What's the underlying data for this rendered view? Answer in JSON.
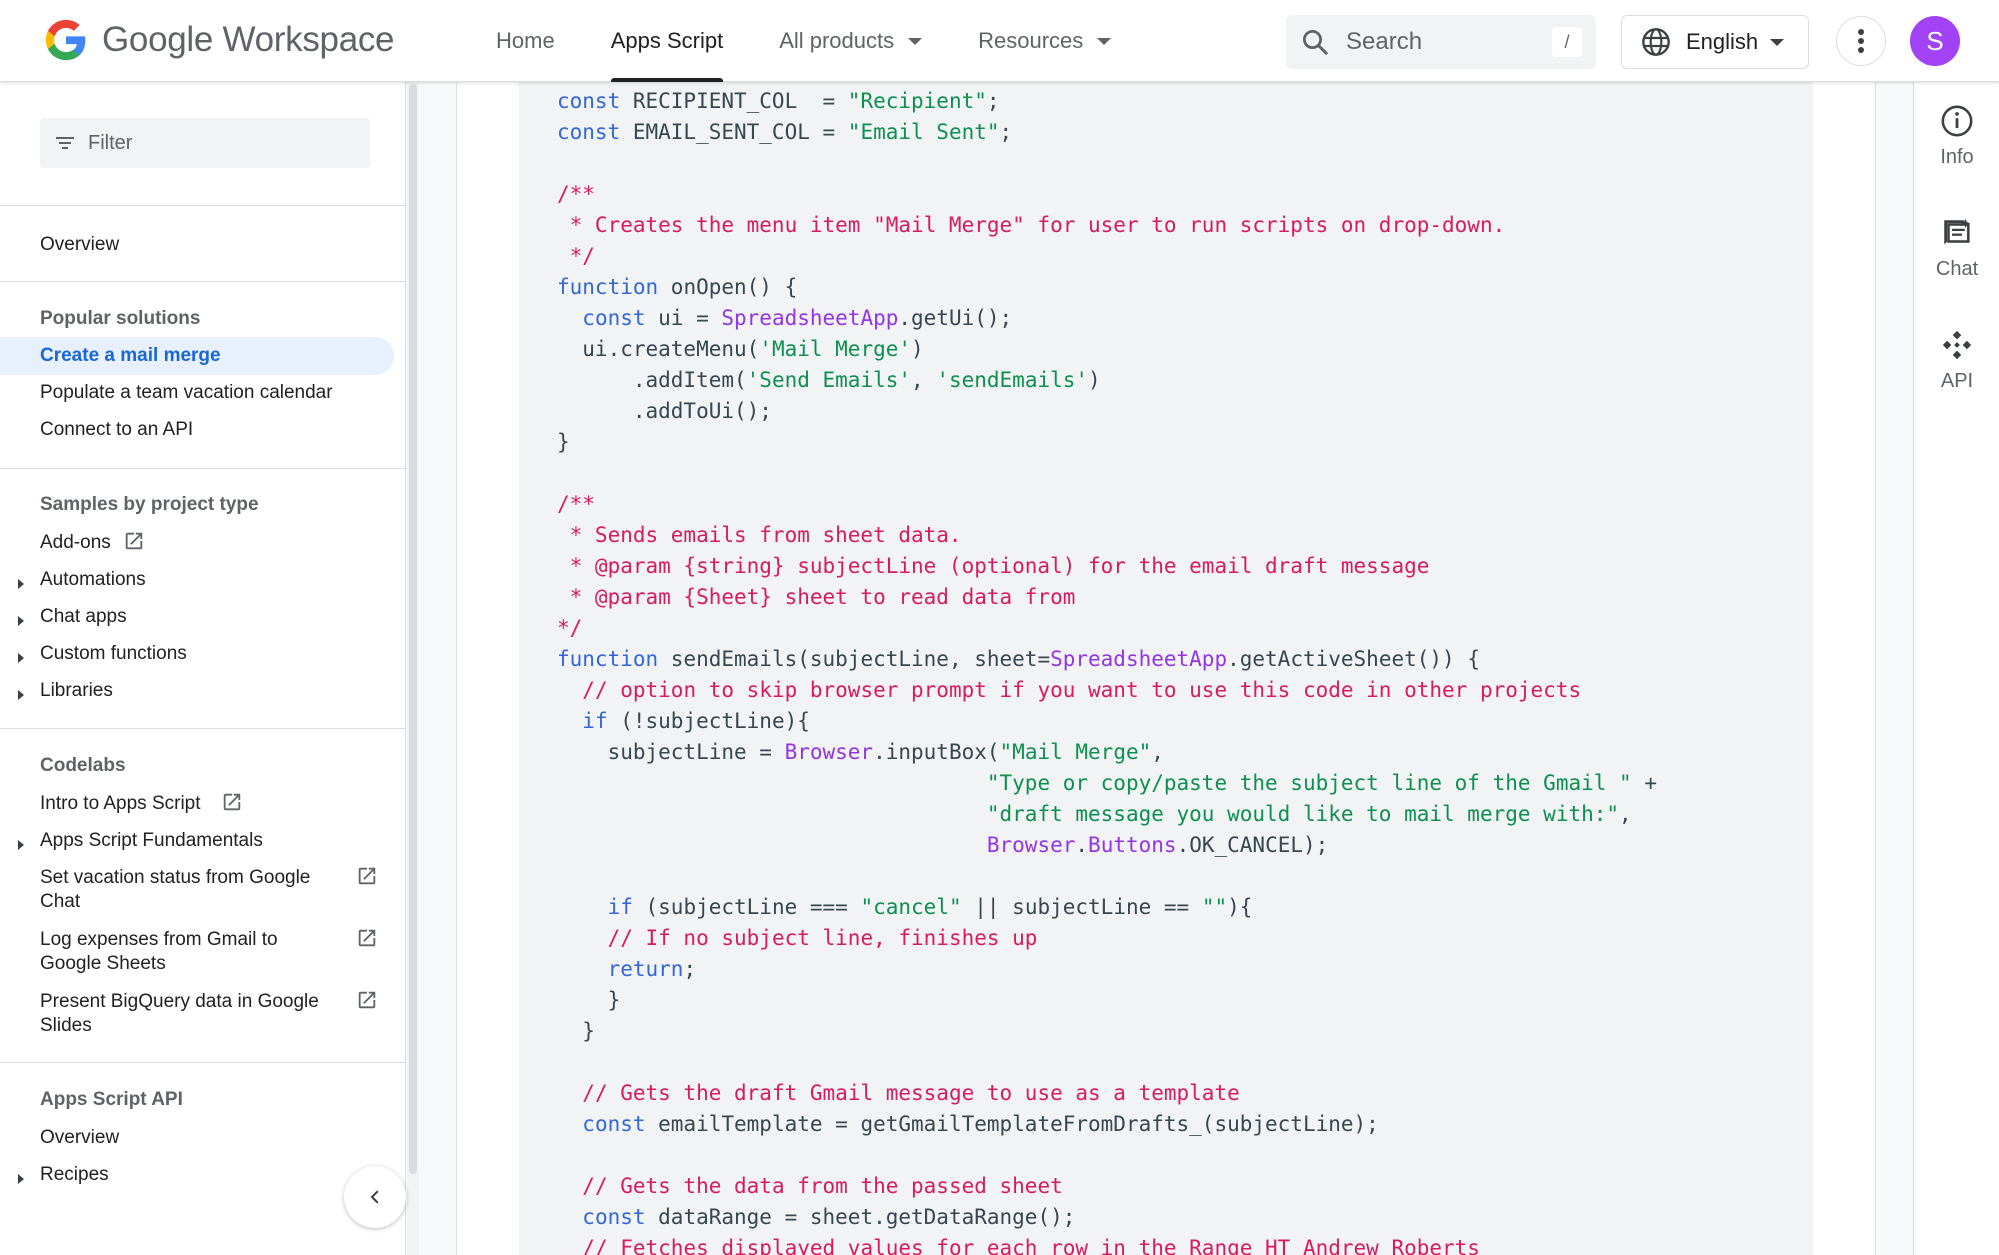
{
  "header": {
    "brand_google": "Google",
    "brand_product": "Workspace",
    "nav": [
      {
        "label": "Home"
      },
      {
        "label": "Apps Script"
      },
      {
        "label": "All products"
      },
      {
        "label": "Resources"
      }
    ],
    "search_placeholder": "Search",
    "search_shortcut": "/",
    "language": "English",
    "avatar_initial": "S"
  },
  "sidebar": {
    "filter_placeholder": "Filter",
    "overview": "Overview",
    "sections": {
      "popular": {
        "heading": "Popular solutions",
        "items": [
          "Create a mail merge",
          "Populate a team vacation calendar",
          "Connect to an API"
        ]
      },
      "samples": {
        "heading": "Samples by project type",
        "items": [
          "Add-ons",
          "Automations",
          "Chat apps",
          "Custom functions",
          "Libraries"
        ]
      },
      "codelabs": {
        "heading": "Codelabs",
        "items": [
          "Intro to Apps Script",
          "Apps Script Fundamentals",
          "Set vacation status from Google Chat",
          "Log expenses from Gmail to Google Sheets",
          "Present BigQuery data in Google Slides"
        ]
      },
      "api": {
        "heading": "Apps Script API",
        "items": [
          "Overview",
          "Recipes"
        ]
      }
    },
    "active_item": "Create a mail merge"
  },
  "code_lines": [
    [
      [
        "k",
        "const"
      ],
      [
        "p",
        " RECIPIENT_COL  = "
      ],
      [
        "s",
        "\"Recipient\""
      ],
      [
        "p",
        ";"
      ]
    ],
    [
      [
        "k",
        "const"
      ],
      [
        "p",
        " EMAIL_SENT_COL = "
      ],
      [
        "s",
        "\"Email Sent\""
      ],
      [
        "p",
        ";"
      ]
    ],
    [],
    [
      [
        "c",
        "/**"
      ]
    ],
    [
      [
        "c",
        " * Creates the menu item \"Mail Merge\" for user to run scripts on drop-down."
      ]
    ],
    [
      [
        "c",
        " */"
      ]
    ],
    [
      [
        "k",
        "function"
      ],
      [
        "p",
        " onOpen() {"
      ]
    ],
    [
      [
        "p",
        "  "
      ],
      [
        "k",
        "const"
      ],
      [
        "p",
        " ui = "
      ],
      [
        "t",
        "SpreadsheetApp"
      ],
      [
        "p",
        ".getUi();"
      ]
    ],
    [
      [
        "p",
        "  ui.createMenu("
      ],
      [
        "s",
        "'Mail Merge'"
      ],
      [
        "p",
        ")"
      ]
    ],
    [
      [
        "p",
        "      .addItem("
      ],
      [
        "s",
        "'Send Emails'"
      ],
      [
        "p",
        ", "
      ],
      [
        "s",
        "'sendEmails'"
      ],
      [
        "p",
        ")"
      ]
    ],
    [
      [
        "p",
        "      .addToUi();"
      ]
    ],
    [
      [
        "p",
        "}"
      ]
    ],
    [],
    [
      [
        "c",
        "/**"
      ]
    ],
    [
      [
        "c",
        " * Sends emails from sheet data."
      ]
    ],
    [
      [
        "c",
        " * @param {string} subjectLine (optional) for the email draft message"
      ]
    ],
    [
      [
        "c",
        " * @param {Sheet} sheet to read data from"
      ]
    ],
    [
      [
        "c",
        "*/"
      ]
    ],
    [
      [
        "k",
        "function"
      ],
      [
        "p",
        " sendEmails(subjectLine, sheet="
      ],
      [
        "t",
        "SpreadsheetApp"
      ],
      [
        "p",
        ".getActiveSheet()) {"
      ]
    ],
    [
      [
        "p",
        "  "
      ],
      [
        "c",
        "// option to skip browser prompt if you want to use this code in other projects"
      ]
    ],
    [
      [
        "p",
        "  "
      ],
      [
        "k",
        "if"
      ],
      [
        "p",
        " (!subjectLine){"
      ]
    ],
    [
      [
        "p",
        "    subjectLine = "
      ],
      [
        "t",
        "Browser"
      ],
      [
        "p",
        ".inputBox("
      ],
      [
        "s",
        "\"Mail Merge\""
      ],
      [
        "p",
        ","
      ]
    ],
    [
      [
        "p",
        "                                  "
      ],
      [
        "s",
        "\"Type or copy/paste the subject line of the Gmail \""
      ],
      [
        "p",
        " +"
      ]
    ],
    [
      [
        "p",
        "                                  "
      ],
      [
        "s",
        "\"draft message you would like to mail merge with:\""
      ],
      [
        "p",
        ","
      ]
    ],
    [
      [
        "p",
        "                                  "
      ],
      [
        "t",
        "Browser"
      ],
      [
        "p",
        "."
      ],
      [
        "t",
        "Buttons"
      ],
      [
        "p",
        ".OK_CANCEL);"
      ]
    ],
    [],
    [
      [
        "p",
        "    "
      ],
      [
        "k",
        "if"
      ],
      [
        "p",
        " (subjectLine === "
      ],
      [
        "s",
        "\"cancel\""
      ],
      [
        "p",
        " || subjectLine == "
      ],
      [
        "s",
        "\"\""
      ],
      [
        "p",
        "){"
      ]
    ],
    [
      [
        "p",
        "    "
      ],
      [
        "c",
        "// If no subject line, finishes up"
      ]
    ],
    [
      [
        "p",
        "    "
      ],
      [
        "k",
        "return"
      ],
      [
        "p",
        ";"
      ]
    ],
    [
      [
        "p",
        "    }"
      ]
    ],
    [
      [
        "p",
        "  }"
      ]
    ],
    [],
    [
      [
        "p",
        "  "
      ],
      [
        "c",
        "// Gets the draft Gmail message to use as a template"
      ]
    ],
    [
      [
        "p",
        "  "
      ],
      [
        "k",
        "const"
      ],
      [
        "p",
        " emailTemplate = getGmailTemplateFromDrafts_(subjectLine);"
      ]
    ],
    [],
    [
      [
        "p",
        "  "
      ],
      [
        "c",
        "// Gets the data from the passed sheet"
      ]
    ],
    [
      [
        "p",
        "  "
      ],
      [
        "k",
        "const"
      ],
      [
        "p",
        " dataRange = sheet.getDataRange();"
      ]
    ],
    [
      [
        "p",
        "  "
      ],
      [
        "c",
        "// Fetches displayed values for each row in the Range HT Andrew Roberts"
      ]
    ]
  ],
  "rail": {
    "info": "Info",
    "chat": "Chat",
    "api": "API"
  },
  "icons": {
    "search": "search-icon",
    "globe": "globe-icon",
    "more": "more-vert-icon",
    "filter": "filter-icon",
    "external": "open-in-new-icon",
    "collapse": "chevron-left-icon"
  },
  "colors": {
    "keyword": "#3367d6",
    "string": "#0d904f",
    "comment": "#d81b60",
    "type": "#9334e6",
    "active_nav": "#1967d2",
    "avatar": "#a142f4"
  }
}
